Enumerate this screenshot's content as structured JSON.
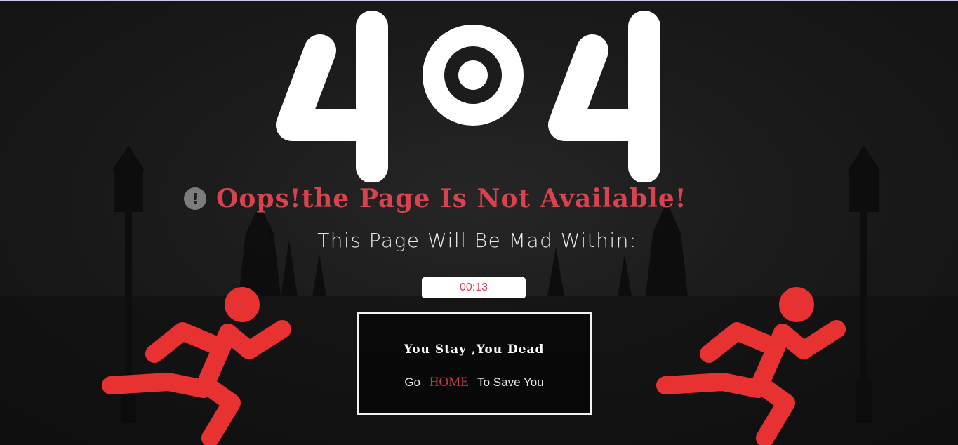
{
  "error_code": "404",
  "headline": {
    "icon": "exclamation-circle-icon",
    "text": "Oops!the Page Is Not Available!"
  },
  "subtitle": "This Page Will Be Mad Within:",
  "countdown": "00:13",
  "message_box": {
    "warning": "You Stay ,You Dead",
    "prefix": "Go",
    "home_link": "HOME",
    "suffix": "To Save You"
  },
  "icons": [
    "exclamation-circle-icon",
    "running-man-icon"
  ],
  "colors": {
    "accent_red": "#d9434f",
    "runner_red": "#e83232",
    "background": "#1b1b1b",
    "digit_white": "#ffffff"
  }
}
